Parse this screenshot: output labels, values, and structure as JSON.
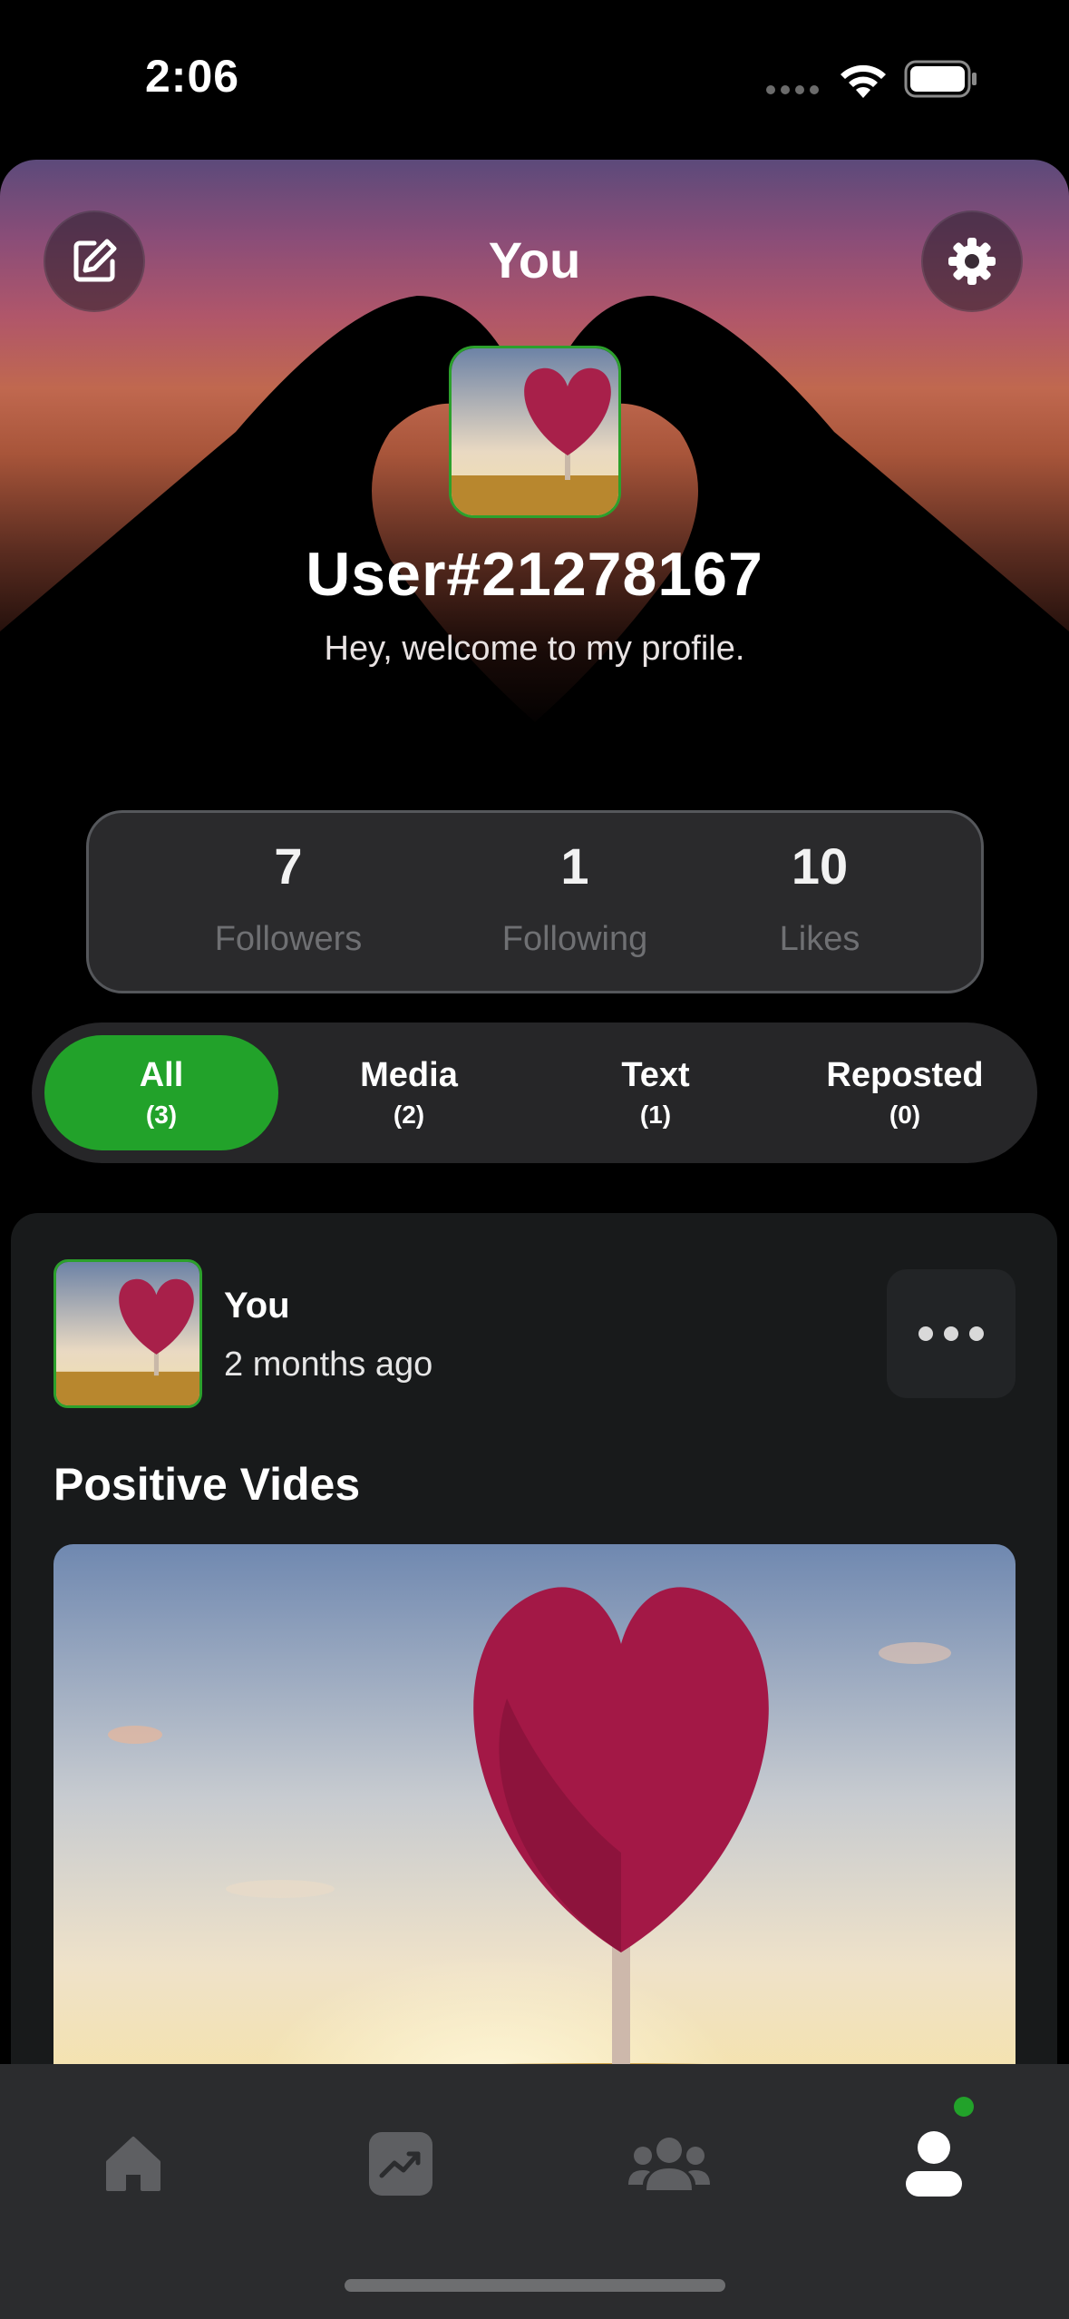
{
  "status_bar": {
    "time": "2:06"
  },
  "header": {
    "title": "You",
    "username": "User#21278167",
    "bio": "Hey, welcome to my profile."
  },
  "stats": [
    {
      "value": "7",
      "label": "Followers"
    },
    {
      "value": "1",
      "label": "Following"
    },
    {
      "value": "10",
      "label": "Likes"
    }
  ],
  "tabs": [
    {
      "label": "All",
      "count": "(3)",
      "active": true
    },
    {
      "label": "Media",
      "count": "(2)",
      "active": false
    },
    {
      "label": "Text",
      "count": "(1)",
      "active": false
    },
    {
      "label": "Reposted",
      "count": "(0)",
      "active": false
    }
  ],
  "post": {
    "author": "You",
    "time": "2 months ago",
    "title": "Positive Vides"
  },
  "bottom_nav": [
    {
      "icon": "home-icon",
      "active": false
    },
    {
      "icon": "trending-icon",
      "active": false
    },
    {
      "icon": "community-icon",
      "active": false
    },
    {
      "icon": "profile-icon",
      "active": true
    }
  ],
  "colors": {
    "accent": "#22a22a",
    "background": "#000000",
    "card": "#181a1b",
    "nav": "#2b2c2e"
  }
}
